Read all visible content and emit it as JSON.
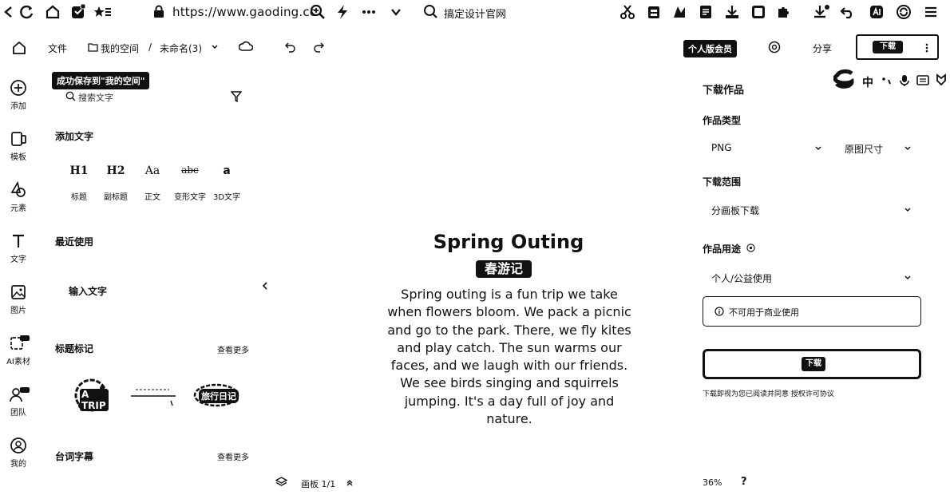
{
  "browser": {
    "url": "https://www.gaoding.cc",
    "search_text": "搞定设计官网"
  },
  "appbar": {
    "file": "文件",
    "my_space": "我的空间",
    "separator": "/",
    "doc_name": "未命名(3)",
    "vip_button": "个人版会员",
    "share": "分享",
    "download": "下载",
    "saved_toast": "成功保存到\"我的空间\""
  },
  "rail": {
    "items": [
      {
        "label": "添加",
        "icon": "plus-circle-icon"
      },
      {
        "label": "模板",
        "icon": "template-icon"
      },
      {
        "label": "元素",
        "icon": "shapes-icon"
      },
      {
        "label": "文字",
        "icon": "text-icon"
      },
      {
        "label": "图片",
        "icon": "image-icon"
      },
      {
        "label": "AI素材",
        "icon": "ai-material-icon"
      },
      {
        "label": "团队",
        "icon": "team-icon"
      },
      {
        "label": "我的",
        "icon": "user-icon"
      }
    ]
  },
  "panel": {
    "search_placeholder": "搜索文字",
    "add_text": "添加文字",
    "text_styles": [
      {
        "glyph": "H1",
        "label": "标题"
      },
      {
        "glyph": "H2",
        "label": "副标题"
      },
      {
        "glyph": "Aa",
        "label": "正文"
      },
      {
        "glyph": "abc",
        "label": "变形文字"
      },
      {
        "glyph": "a",
        "label": "3D文字"
      }
    ],
    "recent": "最近使用",
    "input_text": "输入文字",
    "title_tags": "标题标记",
    "see_more": "查看更多",
    "subtitles": "台词字幕",
    "see_more_2": "查看更多",
    "tag_sample_1": "A TRIP",
    "tag_sample_3": "旅行日记"
  },
  "canvas": {
    "title": "Spring Outing",
    "subtitle": "春游记",
    "body_lines": [
      "Spring outing is a fun trip we take",
      "when flowers bloom. We pack a picnic",
      "and go to the park. There, we fly kites",
      "and play catch. The sun warms our",
      "faces, and we laugh with our friends.",
      "We see birds singing and squirrels",
      "jumping. It's a day full of joy and nature."
    ],
    "page_indicator": "画板 1/1",
    "zoom": "36%",
    "help": "?"
  },
  "download_panel": {
    "title": "下载作品",
    "type_label": "作品类型",
    "type_value": "PNG",
    "size_value": "原图尺寸",
    "range_label": "下载范围",
    "range_value": "分画板下载",
    "use_label": "作品用途",
    "use_value": "个人/公益使用",
    "notice": "不可用于商业使用",
    "download_button": "下载",
    "agreement": "下载即视为您已阅读并同意 授权许可协议"
  },
  "ime": {
    "lang": "中"
  }
}
